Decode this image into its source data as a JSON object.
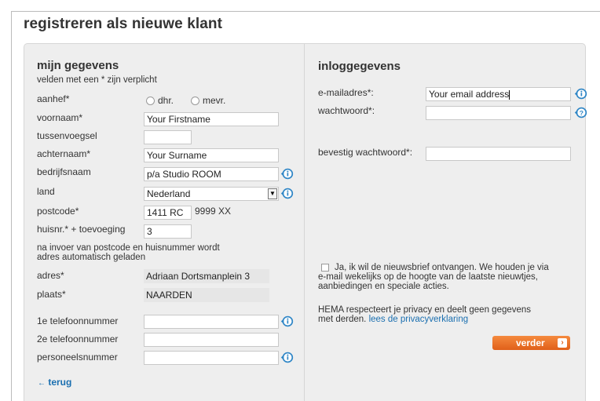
{
  "page": {
    "title": "registreren als nieuwe klant"
  },
  "left": {
    "heading": "mijn gegevens",
    "required_note": "velden met een * zijn verplicht",
    "aanhef": {
      "label": "aanhef*",
      "option1": "dhr.",
      "option2": "mevr."
    },
    "voornaam": {
      "label": "voornaam*",
      "value": "Your Firstname"
    },
    "tussenvoegsel": {
      "label": "tussenvoegsel",
      "value": ""
    },
    "achternaam": {
      "label": "achternaam*",
      "value": "Your Surname"
    },
    "bedrijfsnaam": {
      "label": "bedrijfsnaam",
      "value": "p/a Studio ROOM"
    },
    "land": {
      "label": "land",
      "value": "Nederland"
    },
    "postcode": {
      "label": "postcode*",
      "value": "1411 RC",
      "hint": "9999 XX"
    },
    "huisnr": {
      "label": "huisnr.* + toevoeging",
      "value": "3"
    },
    "auto_note_line1": "na invoer van postcode en huisnummer wordt",
    "auto_note_line2": "adres automatisch geladen",
    "adres": {
      "label": "adres*",
      "value": "Adriaan Dortsmanplein 3"
    },
    "plaats": {
      "label": "plaats*",
      "value": "NAARDEN"
    },
    "telefoon1": {
      "label": "1e telefoonnummer",
      "value": ""
    },
    "telefoon2": {
      "label": "2e telefoonnummer",
      "value": ""
    },
    "personeelsnummer": {
      "label": "personeelsnummer",
      "value": ""
    },
    "back_link": "terug",
    "back_arrow": "←"
  },
  "right": {
    "heading": "inloggegevens",
    "email": {
      "label": "e-mailadres*:",
      "value": "Your email address"
    },
    "wachtwoord": {
      "label": "wachtwoord*:",
      "value": ""
    },
    "bevestig": {
      "label": "bevestig wachtwoord*:",
      "value": ""
    },
    "newsletter_line1": "Ja, ik wil de nieuwsbrief ontvangen. We houden je via",
    "newsletter_line2": "e-mail wekelijks op de hoogte van de laatste nieuwtjes,",
    "newsletter_line3": "aanbiedingen en speciale acties.",
    "privacy_line1": "HEMA respecteert je privacy en deelt geen gegevens",
    "privacy_line2_prefix": "met derden.",
    "privacy_link": "lees de privacyverklaring",
    "submit_label": "verder",
    "submit_arrow": "›"
  },
  "icons": {
    "info": "info-icon",
    "help": "help-icon",
    "dropdown": "dropdown-arrow-icon"
  },
  "colors": {
    "accent": "#e8732a",
    "link": "#1a6fb0",
    "icon": "#2f86c6",
    "panel": "#eeeeee"
  }
}
